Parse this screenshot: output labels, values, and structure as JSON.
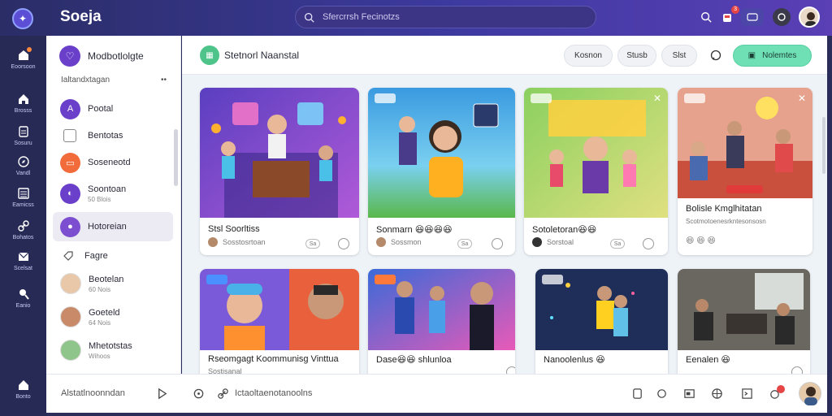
{
  "app": {
    "name": "Soeja"
  },
  "search": {
    "placeholder": "Sfercrrsh Fecinotzs"
  },
  "rail": {
    "items": [
      {
        "label": "Eoorsoon",
        "icon": "inbox-icon"
      },
      {
        "label": "Brosss",
        "icon": "home-icon"
      },
      {
        "label": "Sosuru",
        "icon": "document-icon"
      },
      {
        "label": "Vandl",
        "icon": "compass-icon"
      },
      {
        "label": "Eamicss",
        "icon": "list-icon"
      },
      {
        "label": "Bohatos",
        "icon": "link-icon"
      },
      {
        "label": "Scelsat",
        "icon": "mail-icon"
      },
      {
        "label": "Eanio",
        "icon": "location-icon"
      },
      {
        "label": "Bonto",
        "icon": "home-icon"
      }
    ]
  },
  "sidebar": {
    "header": "Modbotlolgte",
    "sub_label": "Ialtandxtagan",
    "sub_more": "••",
    "items": [
      {
        "title": "Pootal",
        "subtitle": "",
        "color": "#6a3fc9",
        "glyph": "A"
      },
      {
        "title": "Bentotas",
        "subtitle": "",
        "color": "#ffffff",
        "glyph": "☐"
      },
      {
        "title": "Soseneotd",
        "subtitle": "",
        "color": "#f26b3a",
        "glyph": "▭"
      },
      {
        "title": "Soontoan",
        "subtitle": "50 Blois",
        "color": "#6a3fc9",
        "glyph": "◐"
      },
      {
        "title": "Hotoreian",
        "subtitle": "",
        "color": "#7c4fd0",
        "glyph": "●"
      }
    ],
    "section_label": "Fagre",
    "people": [
      {
        "name": "Beotelan",
        "sub": "60 Nois"
      },
      {
        "name": "Goeteld",
        "sub": "64 Nois"
      },
      {
        "name": "Mhetotstas",
        "sub": "Wihoos"
      }
    ]
  },
  "main": {
    "title": "Stetnorl Naanstal",
    "pills": [
      "Kosnon",
      "Stusb",
      "Slst"
    ],
    "primary_button": "Nolemtes",
    "cards": [
      {
        "title": "Stsl Soorltiss",
        "meta": "Sosstosrtoan",
        "badge": "Sa",
        "bg": "#6a4bc4"
      },
      {
        "title": "Sonmarn 😆😆😆😆",
        "meta": "Sossmon",
        "badge": "Sa",
        "bg": "#4aa8d8"
      },
      {
        "title": "Sotoletoran😆😆",
        "meta": "Sorstoal",
        "badge": "Sa",
        "bg": "#6cc45a"
      },
      {
        "title": "Bolisle Kmglhitatan",
        "meta": "Scotmotoenesrkntesonsosn",
        "badge": "",
        "bg": "#e6a28c"
      },
      {
        "title": "Rseomgagt Koommunisg Vinttua",
        "meta": "Sostisanal",
        "badge": "",
        "bg": "#e8603c"
      },
      {
        "title": "Dase😆😆 shlunloa",
        "meta": "",
        "badge": "",
        "bg": "#5a6fc8"
      },
      {
        "title": "Nanoolenlus 😆",
        "meta": "",
        "badge": "",
        "bg": "#243a68"
      },
      {
        "title": "Eenalen 😆",
        "meta": "",
        "badge": "",
        "bg": "#4a4a4a"
      }
    ]
  },
  "bottombar": {
    "left_text": "Alstatlnoonndan",
    "mid_text": "Ictaoltaenotanoolns"
  }
}
